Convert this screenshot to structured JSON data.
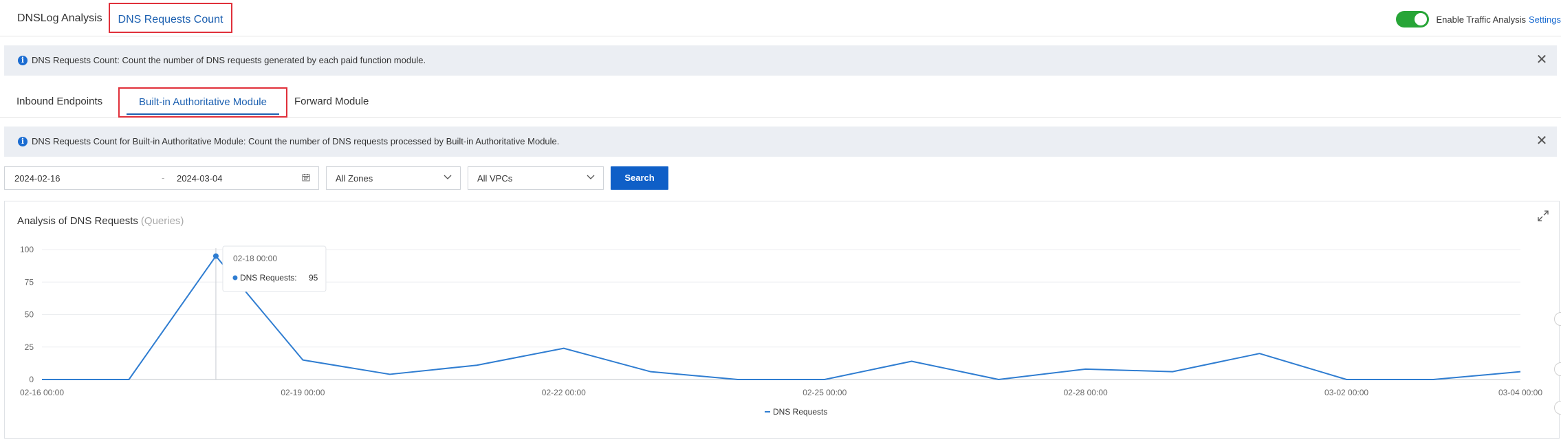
{
  "top_tabs": [
    "DNSLog Analysis",
    "DNS Requests Count"
  ],
  "traffic": {
    "label": "Enable Traffic Analysis",
    "settings": "Settings",
    "enabled": true
  },
  "info_bar_1": {
    "text": "DNS Requests Count: Count the number of DNS requests generated by each paid function module."
  },
  "sub_tabs": [
    "Inbound Endpoints",
    "Built-in Authoritative Module",
    "Forward Module"
  ],
  "info_bar_2": {
    "text": "DNS Requests Count for Built-in Authoritative Module: Count the number of DNS requests processed by Built-in Authoritative Module."
  },
  "filters": {
    "date_start": "2024-02-16",
    "date_sep": "-",
    "date_end": "2024-03-04",
    "zone": "All Zones",
    "vpc": "All VPCs",
    "search_label": "Search"
  },
  "chart": {
    "title": "Analysis of DNS Requests",
    "unit": "(Queries)"
  },
  "colors": {
    "accent": "#1b6cd1",
    "toggle_on": "#27a537",
    "highlight_border": "#e0303a",
    "series": "#2f7dd1"
  },
  "chart_data": {
    "type": "line",
    "title": "Analysis of DNS Requests (Queries)",
    "x": [
      "02-16 00:00",
      "02-17 00:00",
      "02-18 00:00",
      "02-19 00:00",
      "02-20 00:00",
      "02-21 00:00",
      "02-22 00:00",
      "02-23 00:00",
      "02-24 00:00",
      "02-25 00:00",
      "02-26 00:00",
      "02-27 00:00",
      "02-28 00:00",
      "02-29 00:00",
      "03-01 00:00",
      "03-02 00:00",
      "03-03 00:00",
      "03-04 00:00"
    ],
    "x_tick_labels": [
      "02-16 00:00",
      "02-19 00:00",
      "02-22 00:00",
      "02-25 00:00",
      "02-28 00:00",
      "03-02 00:00",
      "03-04 00:00"
    ],
    "series": [
      {
        "name": "DNS Requests",
        "values": [
          0,
          0,
          95,
          15,
          4,
          11,
          24,
          6,
          0,
          0,
          14,
          0,
          8,
          6,
          20,
          0,
          0,
          6
        ]
      }
    ],
    "ylim": [
      0,
      100
    ],
    "yticks": [
      0,
      25,
      50,
      75,
      100
    ],
    "grid": true,
    "legend": "bottom-center",
    "tooltip": {
      "x": "02-18 00:00",
      "series": "DNS Requests:",
      "value": "95"
    }
  }
}
